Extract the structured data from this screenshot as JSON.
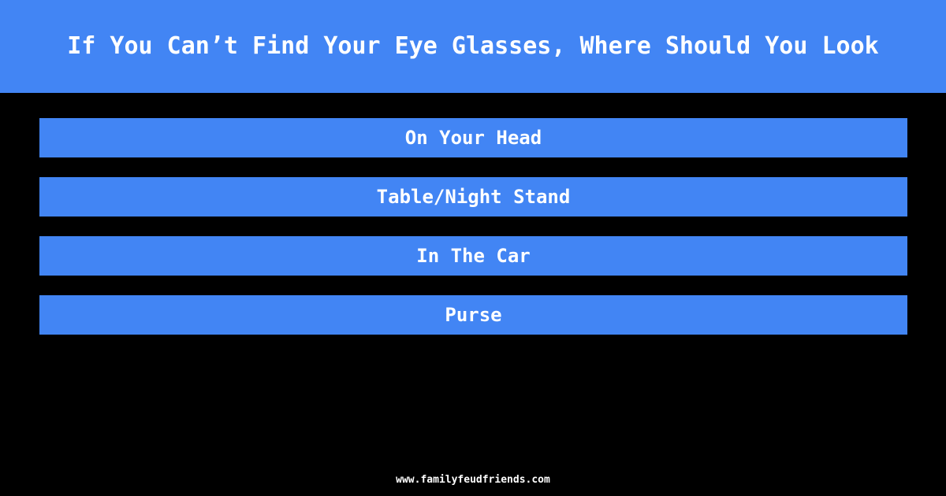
{
  "colors": {
    "background": "#000000",
    "accent": "#4285f4",
    "text_on_accent": "#ffffff",
    "footer_text": "#ffffff"
  },
  "header": {
    "title": "If You Can’t Find Your Eye Glasses, Where Should You Look"
  },
  "answers": [
    {
      "label": "On Your Head"
    },
    {
      "label": "Table/Night Stand"
    },
    {
      "label": "In The Car"
    },
    {
      "label": "Purse"
    }
  ],
  "footer": {
    "site": "www.familyfeudfriends.com"
  }
}
